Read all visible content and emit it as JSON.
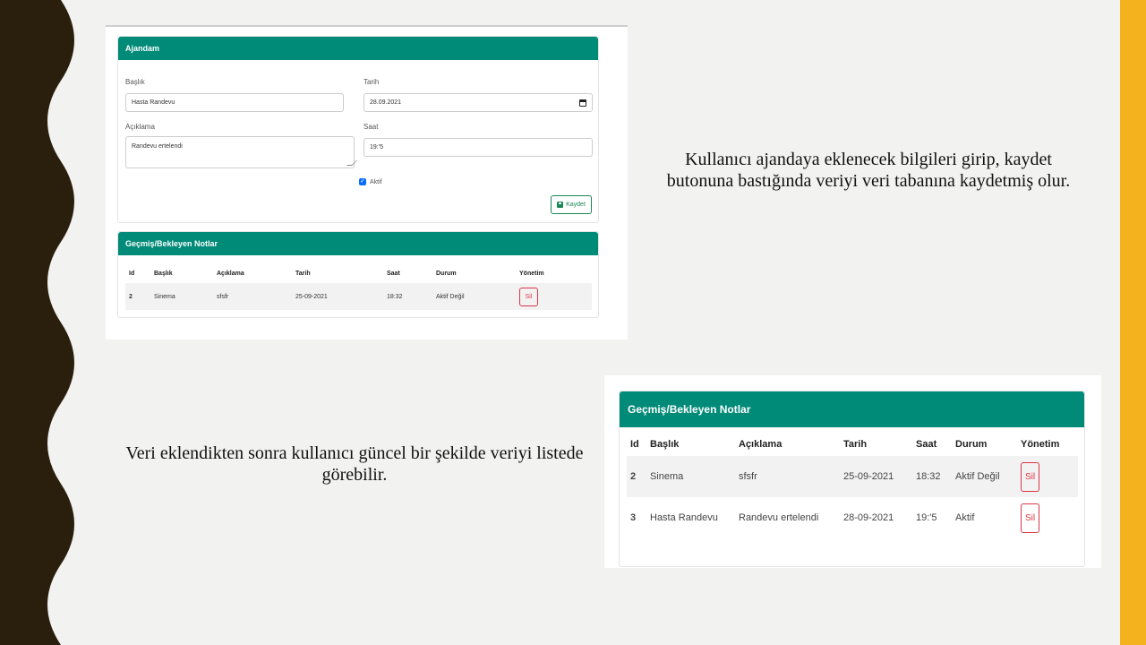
{
  "colors": {
    "accent": "#008a78",
    "danger": "#dc3545",
    "success": "#198754",
    "side_bar": "#f5b21f",
    "left_deco": "#2a1e0c"
  },
  "form": {
    "title": "Ajandam",
    "baslik_label": "Başlık",
    "baslik_value": "Hasta Randevu",
    "tarih_label": "Tarih",
    "tarih_value": "28.09.2021",
    "aciklama_label": "Açıklama",
    "aciklama_value": "Randevu ertelendi",
    "saat_label": "Saat",
    "saat_value": "19:'5",
    "aktif_label": "Aktif",
    "aktif_checked": true,
    "save_label": "Kaydet"
  },
  "notes_small": {
    "title": "Geçmiş/Bekleyen Notlar",
    "headers": [
      "Id",
      "Başlık",
      "Açıklama",
      "Tarih",
      "Saat",
      "Durum",
      "Yönetim"
    ],
    "rows": [
      {
        "id": "2",
        "baslik": "Sinema",
        "aciklama": "sfsfr",
        "tarih": "25-09-2021",
        "saat": "18:32",
        "durum": "Aktif Değil",
        "action": "Sil"
      }
    ]
  },
  "notes_large": {
    "title": "Geçmiş/Bekleyen Notlar",
    "headers": [
      "Id",
      "Başlık",
      "Açıklama",
      "Tarih",
      "Saat",
      "Durum",
      "Yönetim"
    ],
    "rows": [
      {
        "id": "2",
        "baslik": "Sinema",
        "aciklama": "sfsfr",
        "tarih": "25-09-2021",
        "saat": "18:32",
        "durum": "Aktif Değil",
        "action": "Sil"
      },
      {
        "id": "3",
        "baslik": "Hasta Randevu",
        "aciklama": "Randevu ertelendi",
        "tarih": "28-09-2021",
        "saat": "19:'5",
        "durum": "Aktif",
        "action": "Sil"
      }
    ]
  },
  "captions": {
    "top": "Kullanıcı ajandaya eklenecek bilgileri girip, kaydet butonuna bastığında veriyi veri tabanına kaydetmiş olur.",
    "bottom": "Veri eklendikten sonra kullanıcı güncel bir şekilde veriyi listede görebilir."
  }
}
